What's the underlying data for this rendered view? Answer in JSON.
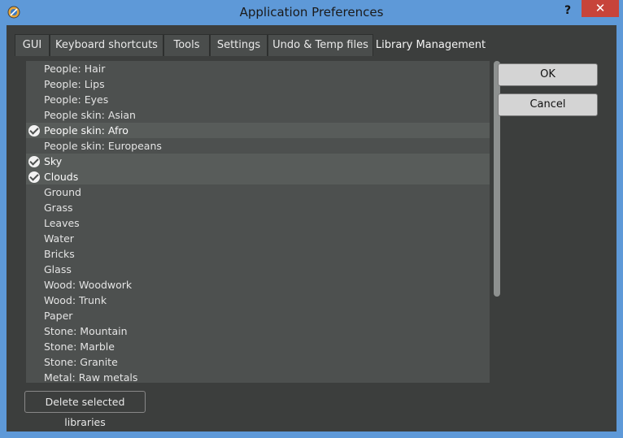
{
  "window": {
    "title": "Application Preferences",
    "help_label": "?",
    "close_label": "✕"
  },
  "tabs": [
    {
      "label": "GUI",
      "active": false
    },
    {
      "label": "Keyboard shortcuts",
      "active": false
    },
    {
      "label": "Tools",
      "active": false
    },
    {
      "label": "Settings",
      "active": false
    },
    {
      "label": "Undo & Temp files",
      "active": false
    },
    {
      "label": "Library Management",
      "active": true
    }
  ],
  "libraries": [
    {
      "label": "People: Hair",
      "checked": false
    },
    {
      "label": "People: Lips",
      "checked": false
    },
    {
      "label": "People: Eyes",
      "checked": false
    },
    {
      "label": "People skin: Asian",
      "checked": false
    },
    {
      "label": "People skin: Afro",
      "checked": true
    },
    {
      "label": "People skin: Europeans",
      "checked": false
    },
    {
      "label": "Sky",
      "checked": true
    },
    {
      "label": "Clouds",
      "checked": true
    },
    {
      "label": "Ground",
      "checked": false
    },
    {
      "label": "Grass",
      "checked": false
    },
    {
      "label": "Leaves",
      "checked": false
    },
    {
      "label": "Water",
      "checked": false
    },
    {
      "label": "Bricks",
      "checked": false
    },
    {
      "label": "Glass",
      "checked": false
    },
    {
      "label": "Wood: Woodwork",
      "checked": false
    },
    {
      "label": "Wood: Trunk",
      "checked": false
    },
    {
      "label": "Paper",
      "checked": false
    },
    {
      "label": "Stone: Mountain",
      "checked": false
    },
    {
      "label": "Stone: Marble",
      "checked": false
    },
    {
      "label": "Stone: Granite",
      "checked": false
    },
    {
      "label": "Metal: Raw metals",
      "checked": false
    }
  ],
  "buttons": {
    "ok": "OK",
    "cancel": "Cancel",
    "delete": "Delete selected libraries"
  },
  "icons": {
    "app": "app-logo-icon",
    "check": "checkmark-icon"
  },
  "colors": {
    "frame": "#5e99d8",
    "background": "#3c3e3d",
    "list": "#4d504f",
    "close": "#c7443a"
  }
}
